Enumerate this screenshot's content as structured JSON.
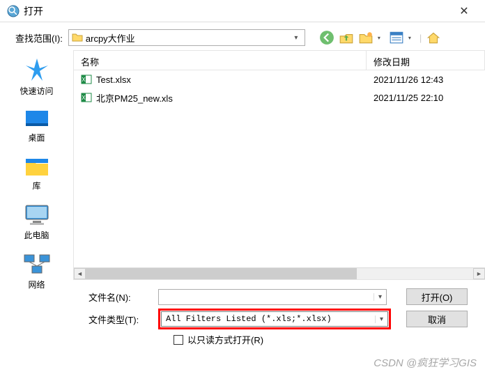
{
  "title": "打开",
  "lookin": {
    "label": "查找范围(I):",
    "value": "arcpy大作业"
  },
  "columns": {
    "name": "名称",
    "date": "修改日期"
  },
  "files": [
    {
      "name": "Test.xlsx",
      "date": "2021/11/26 12:43"
    },
    {
      "name": "北京PM25_new.xls",
      "date": "2021/11/25 22:10"
    }
  ],
  "places": {
    "quickaccess": "快速访问",
    "desktop": "桌面",
    "libraries": "库",
    "thispc": "此电脑",
    "network": "网络"
  },
  "form": {
    "filename_label": "文件名(N):",
    "filename_value": "",
    "filetype_label": "文件类型(T):",
    "filetype_value": "All Filters Listed (*.xls;*.xlsx)",
    "readonly_label": "以只读方式打开(R)",
    "open_btn": "打开(O)",
    "cancel_btn": "取消"
  },
  "watermark": "CSDN @疯狂学习GIS"
}
